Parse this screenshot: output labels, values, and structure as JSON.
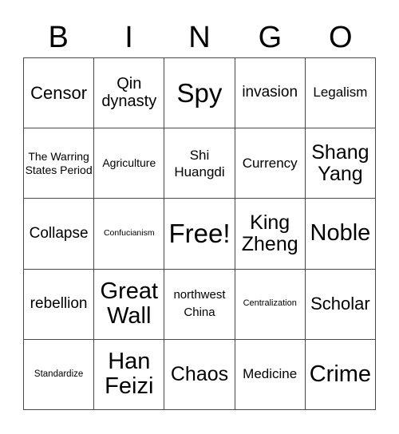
{
  "header": {
    "letters": [
      "B",
      "I",
      "N",
      "G",
      "O"
    ]
  },
  "grid": {
    "rows": [
      [
        "Censor",
        "Qin dynasty",
        "Spy",
        "invasion",
        "Legalism"
      ],
      [
        "The Warring States Period",
        "Agriculture",
        "Shi Huangdi",
        "Currency",
        "Shang Yang"
      ],
      [
        "Collapse",
        "Confucianism",
        "Free!",
        "King Zheng",
        "Noble"
      ],
      [
        "rebellion",
        "Great Wall",
        "northwest China",
        "Centralization",
        "Scholar"
      ],
      [
        "Standardize",
        "Han Feizi",
        "Chaos",
        "Medicine",
        "Crime"
      ]
    ]
  }
}
